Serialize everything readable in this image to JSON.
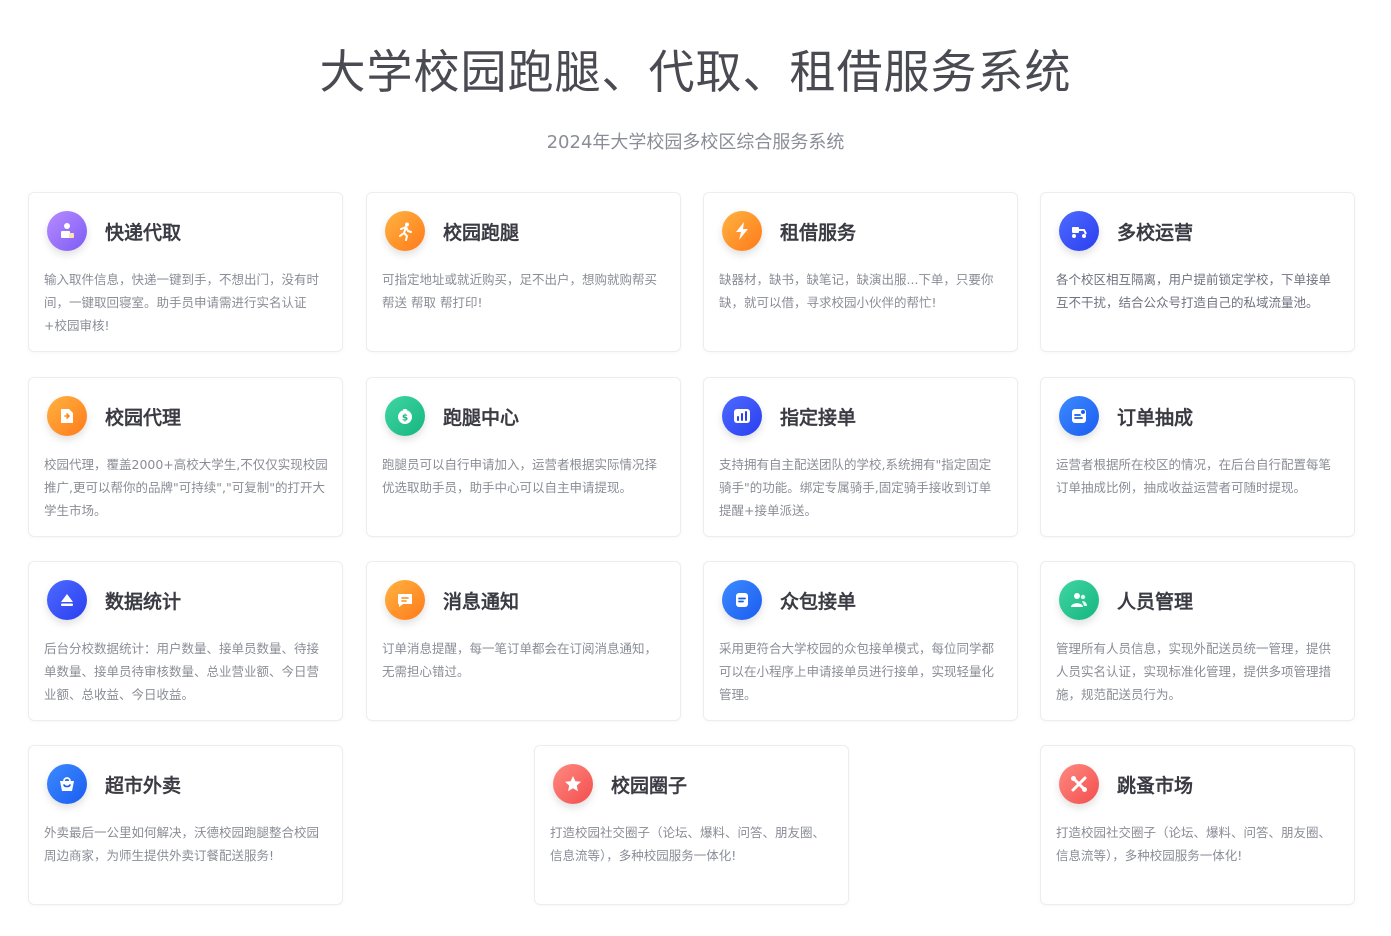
{
  "header": {
    "title": "大学校园跑腿、代取、租借服务系统",
    "subtitle": "2024年大学校园多校区综合服务系统"
  },
  "cards": [
    {
      "title": "快递代取",
      "desc": "输入取件信息，快递一键到手，不想出门，没有时间，一键取回寝室。助手员申请需进行实名认证+校园审核!",
      "icon": "package-person-icon",
      "color_from": "#b78bff",
      "color_to": "#7d5cf5"
    },
    {
      "title": "校园跑腿",
      "desc": "可指定地址或就近购买，足不出户，想购就购帮买 帮送 帮取 帮打印!",
      "icon": "running-person-icon",
      "color_from": "#ffb340",
      "color_to": "#ff7a1a"
    },
    {
      "title": "租借服务",
      "desc": "缺器材，缺书，缺笔记，缺演出服...下单，只要你缺，就可以借，寻求校园小伙伴的帮忙!",
      "icon": "lightning-icon",
      "color_from": "#ffb340",
      "color_to": "#ff7a1a"
    },
    {
      "title": "多校运营",
      "desc": "各个校区相互隔离，用户提前锁定学校，下单接单互不干扰，结合公众号打造自己的私域流量池。",
      "icon": "scooter-icon",
      "color_from": "#4d6bff",
      "color_to": "#2a3ef0"
    },
    {
      "title": "校园代理",
      "desc": "校园代理，覆盖2000+高校大学生,不仅仅实现校园推广,更可以帮你的品牌\"可持续\",\"可复制\"的打开大学生市场。",
      "icon": "agent-icon",
      "color_from": "#ffb340",
      "color_to": "#ff7a1a"
    },
    {
      "title": "跑腿中心",
      "desc": "跑腿员可以自行申请加入，运营者根据实际情况择优选取助手员，助手中心可以自主申请提现。",
      "icon": "money-bag-icon",
      "color_from": "#3fd6a4",
      "color_to": "#17b57f"
    },
    {
      "title": "指定接单",
      "desc": "支持拥有自主配送团队的学校,系统拥有\"指定固定骑手\"的功能。绑定专属骑手,固定骑手接收到订单提醒+接单派送。",
      "icon": "chart-icon",
      "color_from": "#4d6bff",
      "color_to": "#2a3ef0"
    },
    {
      "title": "订单抽成",
      "desc": "运营者根据所在校区的情况，在后台自行配置每笔订单抽成比例，抽成收益运营者可随时提现。",
      "icon": "order-icon",
      "color_from": "#3d8bff",
      "color_to": "#1a5cf0"
    },
    {
      "title": "数据统计",
      "desc": "后台分校数据统计：用户数量、接单员数量、待接单数量、接单员待审核数量、总业营业额、今日营业额、总收益、今日收益。",
      "icon": "stats-icon",
      "color_from": "#4d6bff",
      "color_to": "#2a3ef0"
    },
    {
      "title": "消息通知",
      "desc": "订单消息提醒，每一笔订单都会在订阅消息通知，无需担心错过。",
      "icon": "message-icon",
      "color_from": "#ffb340",
      "color_to": "#ff7a1a"
    },
    {
      "title": "众包接单",
      "desc": "采用更符合大学校园的众包接单模式，每位同学都可以在小程序上申请接单员进行接单，实现轻量化管理。",
      "icon": "document-icon",
      "color_from": "#3d8bff",
      "color_to": "#1a5cf0"
    },
    {
      "title": "人员管理",
      "desc": "管理所有人员信息，实现外配送员统一管理，提供人员实名认证，实现标准化管理，提供多项管理措施，规范配送员行为。",
      "icon": "people-icon",
      "color_from": "#3fd6a4",
      "color_to": "#17b57f"
    },
    {
      "title": "超市外卖",
      "desc": "外卖最后一公里如何解决，沃德校园跑腿整合校园周边商家，为师生提供外卖订餐配送服务!",
      "icon": "basket-icon",
      "color_from": "#3d8bff",
      "color_to": "#1a5cf0"
    },
    {
      "title": "校园圈子",
      "desc": "打造校园社交圈子（论坛、爆料、问答、朋友圈、信息流等），多种校园服务一体化!",
      "icon": "star-icon",
      "color_from": "#ff8a80",
      "color_to": "#f24e4e"
    },
    {
      "title": "跳蚤市场",
      "desc": "打造校园社交圈子（论坛、爆料、问答、朋友圈、信息流等），多种校园服务一体化!",
      "icon": "tools-icon",
      "color_from": "#ff8a80",
      "color_to": "#f24e4e"
    }
  ]
}
